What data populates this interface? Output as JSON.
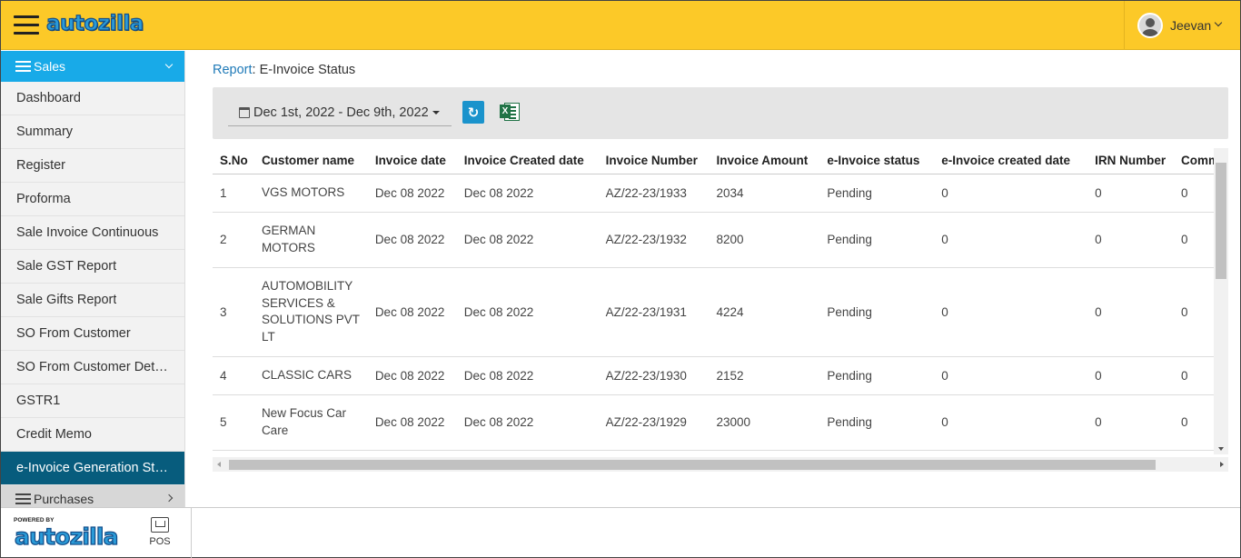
{
  "header": {
    "logo_text": "autozilla",
    "user_name": "Jeevan"
  },
  "sidebar": {
    "section_label": "Sales",
    "items": [
      {
        "label": "Dashboard"
      },
      {
        "label": "Summary"
      },
      {
        "label": "Register"
      },
      {
        "label": "Proforma"
      },
      {
        "label": "Sale Invoice Continuous"
      },
      {
        "label": "Sale GST Report"
      },
      {
        "label": "Sale Gifts Report"
      },
      {
        "label": "SO From Customer"
      },
      {
        "label": "SO From Customer Details"
      },
      {
        "label": "GSTR1"
      },
      {
        "label": "Credit Memo"
      },
      {
        "label": "e-Invoice Generation Status"
      }
    ],
    "next_section_label": "Purchases"
  },
  "footer": {
    "powered_by": "POWERED BY",
    "logo_text": "autozilla",
    "pos_label": "POS"
  },
  "breadcrumb": {
    "link": "Report",
    "separator": ":",
    "current": "E-Invoice Status"
  },
  "toolbar": {
    "date_range": "Dec 1st, 2022 - Dec 9th, 2022",
    "refresh_icon": "↻",
    "excel_icon": "X"
  },
  "table": {
    "columns": [
      "S.No",
      "Customer name",
      "Invoice date",
      "Invoice Created date",
      "Invoice Number",
      "Invoice Amount",
      "e-Invoice status",
      "e-Invoice created date",
      "IRN Number",
      "Comm"
    ],
    "rows": [
      {
        "sno": "1",
        "customer": "VGS MOTORS",
        "invoice_date": "Dec 08 2022",
        "created_date": "Dec 08 2022",
        "number": "AZ/22-23/1933",
        "amount": "2034",
        "status": "Pending",
        "einv_created": "0",
        "irn": "0",
        "comm": "0"
      },
      {
        "sno": "2",
        "customer": "GERMAN MOTORS",
        "invoice_date": "Dec 08 2022",
        "created_date": "Dec 08 2022",
        "number": "AZ/22-23/1932",
        "amount": "8200",
        "status": "Pending",
        "einv_created": "0",
        "irn": "0",
        "comm": "0"
      },
      {
        "sno": "3",
        "customer": "AUTOMOBILITY SERVICES & SOLUTIONS PVT LT",
        "invoice_date": "Dec 08 2022",
        "created_date": "Dec 08 2022",
        "number": "AZ/22-23/1931",
        "amount": "4224",
        "status": "Pending",
        "einv_created": "0",
        "irn": "0",
        "comm": "0"
      },
      {
        "sno": "4",
        "customer": "CLASSIC CARS",
        "invoice_date": "Dec 08 2022",
        "created_date": "Dec 08 2022",
        "number": "AZ/22-23/1930",
        "amount": "2152",
        "status": "Pending",
        "einv_created": "0",
        "irn": "0",
        "comm": "0"
      },
      {
        "sno": "5",
        "customer": "New Focus Car Care",
        "invoice_date": "Dec 08 2022",
        "created_date": "Dec 08 2022",
        "number": "AZ/22-23/1929",
        "amount": "23000",
        "status": "Pending",
        "einv_created": "0",
        "irn": "0",
        "comm": "0"
      }
    ]
  },
  "colors": {
    "header_bg": "#fcc928",
    "sidebar_head_bg": "#18aae8",
    "sidebar_active_bg": "#075c7d",
    "link": "#1f7ab8",
    "refresh_bg": "#1a93cc",
    "excel_green": "#217346"
  }
}
